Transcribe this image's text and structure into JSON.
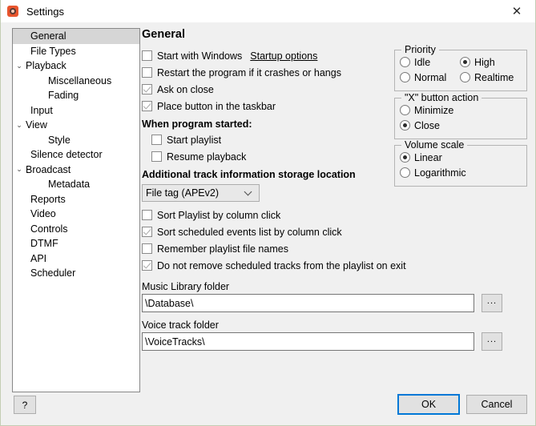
{
  "window": {
    "title": "Settings",
    "icon": "app-headphones-icon",
    "close_label": "✕"
  },
  "sidebar": {
    "items": [
      {
        "label": "General",
        "level": 0,
        "chevron": "",
        "selected": true
      },
      {
        "label": "File Types",
        "level": 0,
        "chevron": "",
        "selected": false
      },
      {
        "label": "Playback",
        "level": 0,
        "chevron": "⌄",
        "selected": false
      },
      {
        "label": "Miscellaneous",
        "level": 1,
        "chevron": "",
        "selected": false
      },
      {
        "label": "Fading",
        "level": 1,
        "chevron": "",
        "selected": false
      },
      {
        "label": "Input",
        "level": 0,
        "chevron": "",
        "selected": false
      },
      {
        "label": "View",
        "level": 0,
        "chevron": "⌄",
        "selected": false
      },
      {
        "label": "Style",
        "level": 1,
        "chevron": "",
        "selected": false
      },
      {
        "label": "Silence detector",
        "level": 0,
        "chevron": "",
        "selected": false
      },
      {
        "label": "Broadcast",
        "level": 0,
        "chevron": "⌄",
        "selected": false
      },
      {
        "label": "Metadata",
        "level": 1,
        "chevron": "",
        "selected": false
      },
      {
        "label": "Reports",
        "level": 0,
        "chevron": "",
        "selected": false
      },
      {
        "label": "Video",
        "level": 0,
        "chevron": "",
        "selected": false
      },
      {
        "label": "Controls",
        "level": 0,
        "chevron": "",
        "selected": false
      },
      {
        "label": "DTMF",
        "level": 0,
        "chevron": "",
        "selected": false
      },
      {
        "label": "API",
        "level": 0,
        "chevron": "",
        "selected": false
      },
      {
        "label": "Scheduler",
        "level": 0,
        "chevron": "",
        "selected": false
      }
    ]
  },
  "main": {
    "page_title": "General",
    "checkboxes_top": [
      {
        "label": "Start with Windows",
        "checked": false
      },
      {
        "label": "Restart the program if it crashes or hangs",
        "checked": false
      },
      {
        "label": "Ask on close",
        "checked": true
      },
      {
        "label": "Place button in the taskbar",
        "checked": true
      }
    ],
    "startup_options_link": "Startup options",
    "when_started": {
      "heading": "When program started:",
      "checkboxes": [
        {
          "label": "Start playlist",
          "checked": false
        },
        {
          "label": "Resume playback",
          "checked": false
        }
      ]
    },
    "storage_location": {
      "heading": "Additional track information storage location",
      "selected": "File tag (APEv2)",
      "options": [
        "File tag (APEv2)"
      ]
    },
    "checkboxes_bottom": [
      {
        "label": "Sort Playlist by column click",
        "checked": false
      },
      {
        "label": "Sort scheduled events list by column click",
        "checked": true
      },
      {
        "label": "Remember playlist file names",
        "checked": false
      },
      {
        "label": "Do not remove scheduled tracks from the playlist on exit",
        "checked": true
      }
    ],
    "music_library": {
      "label": "Music Library folder",
      "value": "\\Database\\",
      "browse_label": "..."
    },
    "voice_track": {
      "label": "Voice track folder",
      "value": "\\VoiceTracks\\",
      "browse_label": "..."
    }
  },
  "groups": {
    "priority": {
      "title": "Priority",
      "column1": [
        {
          "label": "Idle",
          "selected": false
        },
        {
          "label": "Normal",
          "selected": false
        }
      ],
      "column2": [
        {
          "label": "High",
          "selected": true
        },
        {
          "label": "Realtime",
          "selected": false
        }
      ]
    },
    "x_button": {
      "title": "\"X\" button action",
      "options": [
        {
          "label": "Minimize",
          "selected": false
        },
        {
          "label": "Close",
          "selected": true
        }
      ]
    },
    "volume_scale": {
      "title": "Volume scale",
      "options": [
        {
          "label": "Linear",
          "selected": true
        },
        {
          "label": "Logarithmic",
          "selected": false
        }
      ]
    }
  },
  "footer": {
    "help_label": "?",
    "ok_label": "OK",
    "cancel_label": "Cancel"
  },
  "colors": {
    "accent": "#0078d7",
    "selection": "#d6d6d6",
    "window_bg": "#f0f0f0",
    "icon": "#e8552d"
  }
}
